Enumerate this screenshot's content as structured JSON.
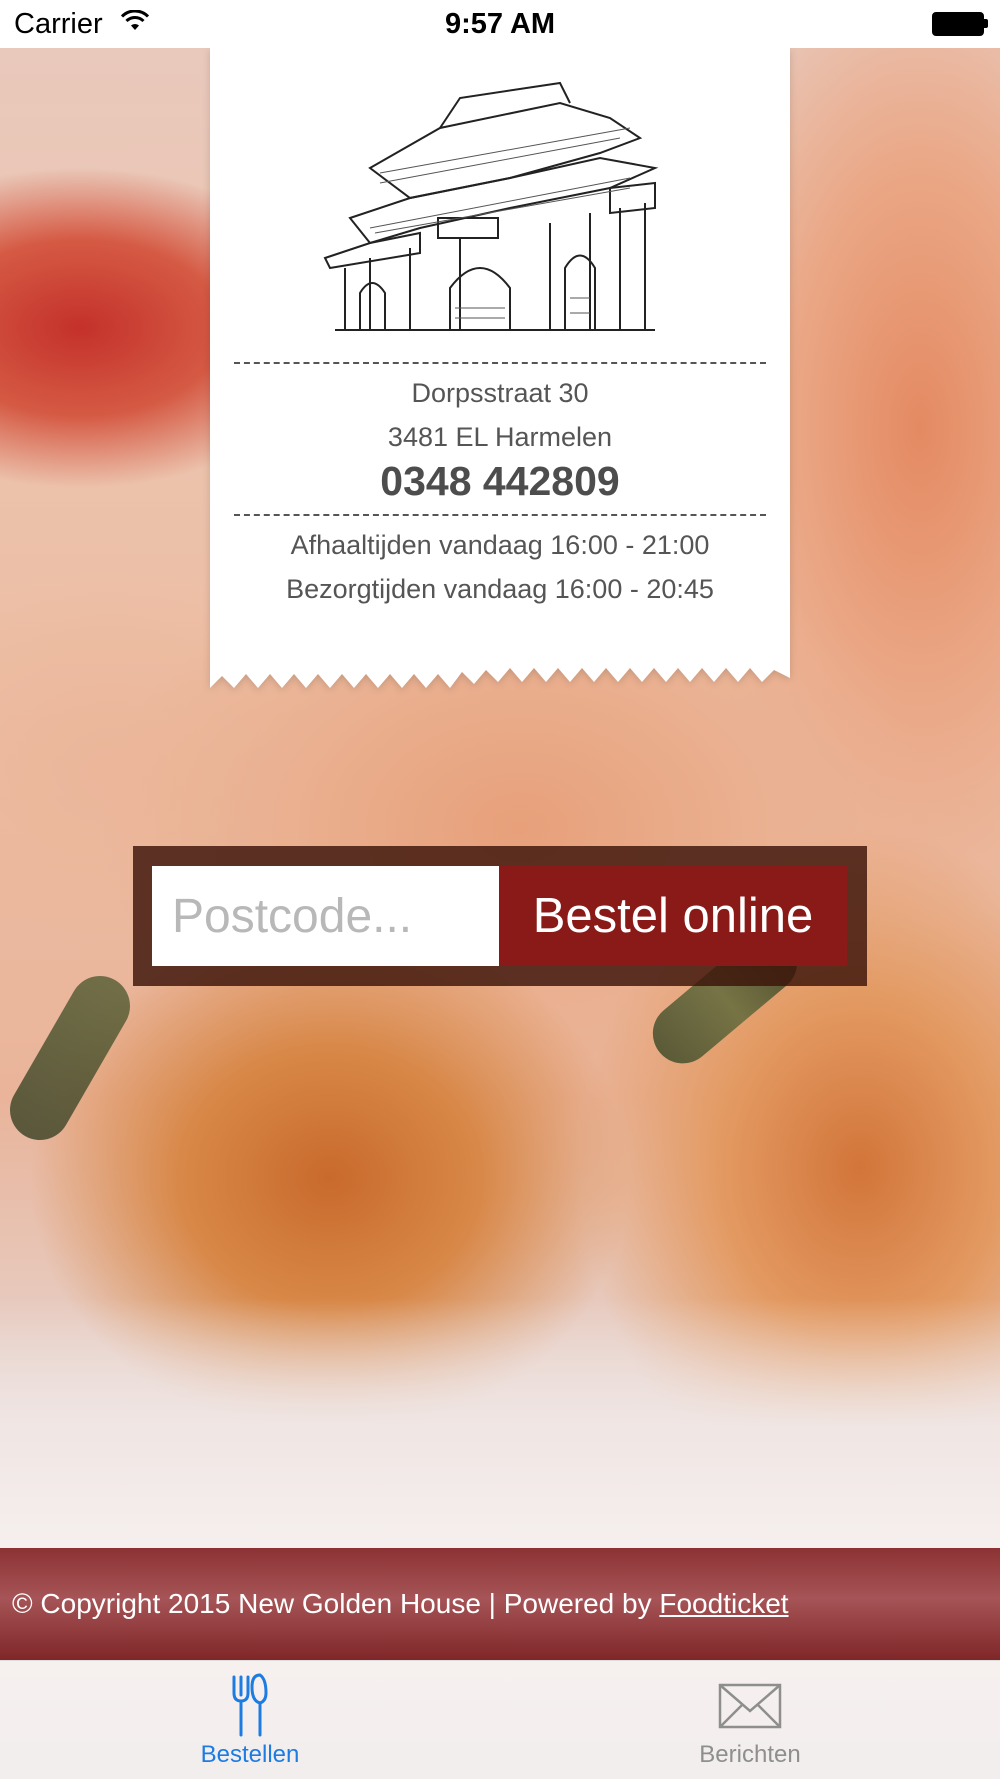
{
  "status_bar": {
    "carrier": "Carrier",
    "time": "9:57 AM"
  },
  "receipt": {
    "address_line1": "Dorpsstraat 30",
    "address_line2": "3481 EL Harmelen",
    "phone": "0348 442809",
    "pickup_hours": "Afhaaltijden vandaag 16:00 - 21:00",
    "delivery_hours": "Bezorgtijden vandaag 16:00 - 20:45"
  },
  "order_form": {
    "postcode_placeholder": "Postcode...",
    "postcode_value": "",
    "submit_label": "Bestel online"
  },
  "footer": {
    "copyright_text": "© Copyright 2015 New Golden House | Powered by ",
    "link_label": "Foodticket"
  },
  "tabbar": {
    "tabs": [
      {
        "label": "Bestellen",
        "icon": "fork-knife-icon",
        "active": true
      },
      {
        "label": "Berichten",
        "icon": "envelope-icon",
        "active": false
      }
    ]
  },
  "colors": {
    "accent": "#8a1a17",
    "tab_active": "#1e7be0",
    "tab_inactive": "#8e8e8e",
    "footer": "#9a4244"
  }
}
